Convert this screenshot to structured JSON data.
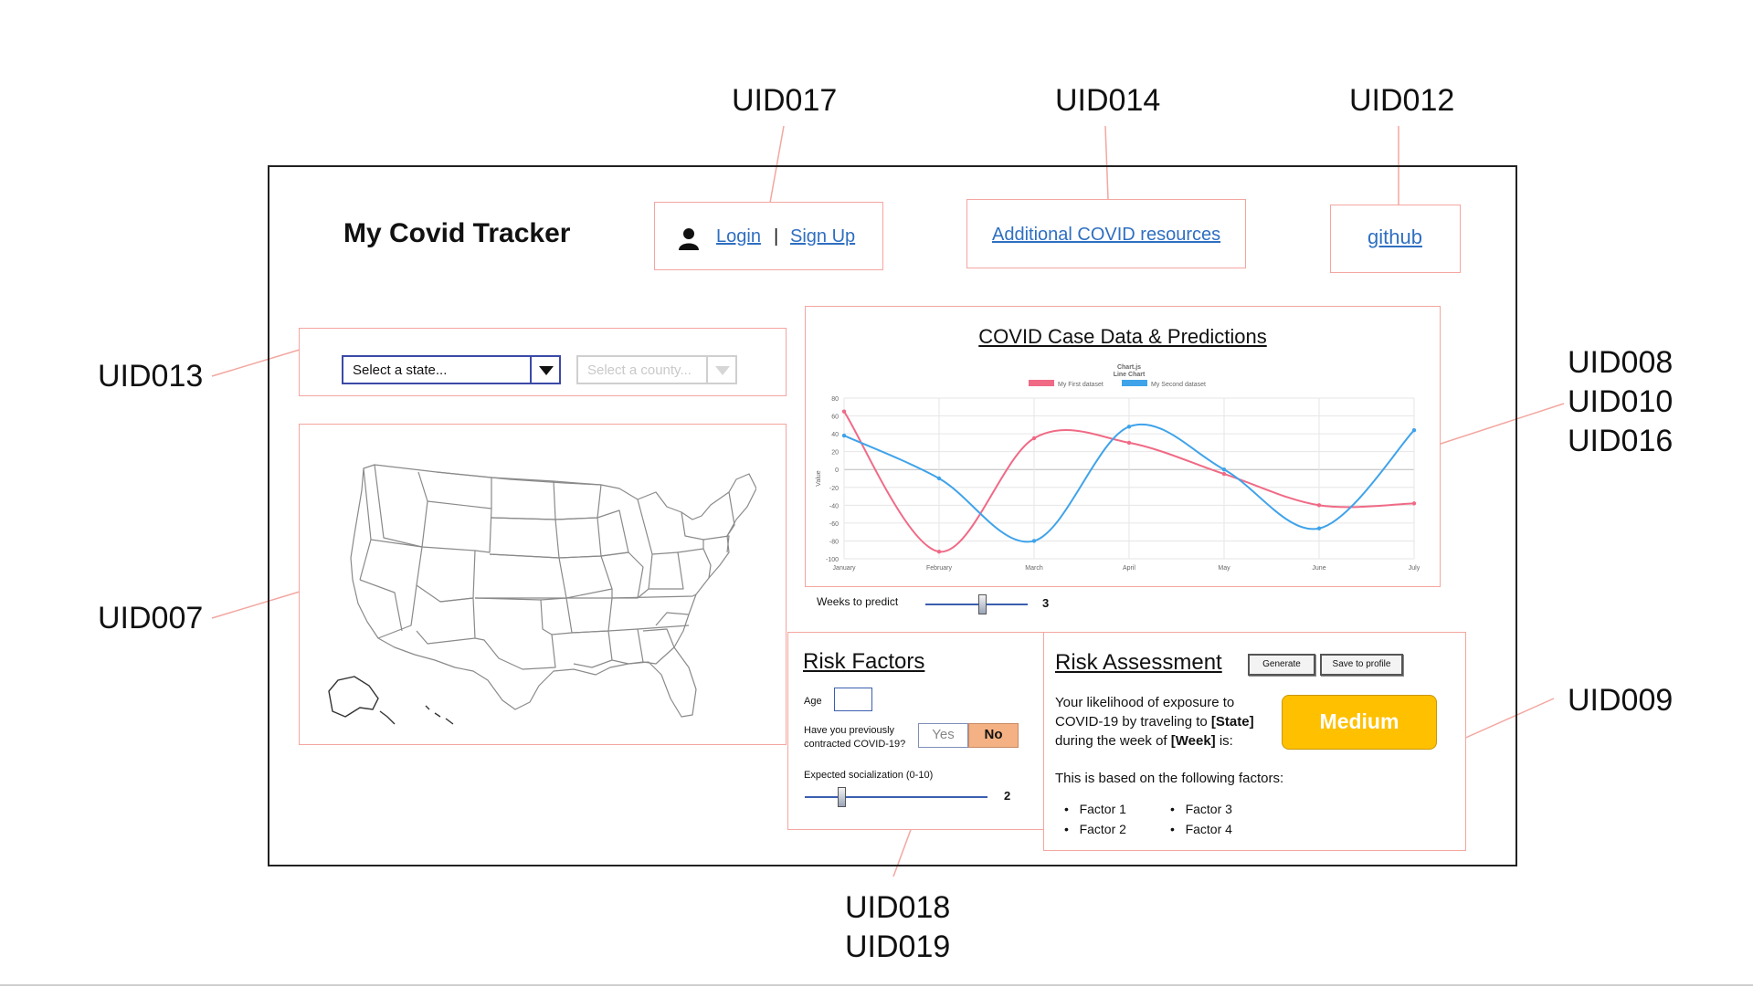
{
  "annotations": {
    "uid017": "UID017",
    "uid014": "UID014",
    "uid012": "UID012",
    "uid013": "UID013",
    "uid007": "UID007",
    "uid008": "UID008",
    "uid010": "UID010",
    "uid016": "UID016",
    "uid009": "UID009",
    "uid018": "UID018",
    "uid019": "UID019"
  },
  "header": {
    "app_title": "My Covid Tracker",
    "login": "Login",
    "separator": "|",
    "signup": "Sign Up",
    "resources": "Additional COVID resources",
    "github": "github"
  },
  "selectors": {
    "state_value": "Select a state...",
    "county_value": "Select a county..."
  },
  "chart": {
    "title": "COVID Case Data & Predictions",
    "weeks_label": "Weeks to predict",
    "weeks_value": "3",
    "weeks_fraction": 0.55
  },
  "chart_data": {
    "type": "line",
    "title": "Chart.js Line Chart",
    "ylabel": "Value",
    "xlabel": "",
    "categories": [
      "January",
      "February",
      "March",
      "April",
      "May",
      "June",
      "July"
    ],
    "ylim": [
      -100,
      80
    ],
    "yticks": [
      80,
      60,
      40,
      20,
      0,
      -20,
      -40,
      -60,
      -80,
      -100
    ],
    "grid": true,
    "legend": "top",
    "series": [
      {
        "name": "My First dataset",
        "color": "#f06a86",
        "values": [
          65,
          -92,
          35,
          30,
          -5,
          -40,
          -38
        ]
      },
      {
        "name": "My Second dataset",
        "color": "#3fa3ea",
        "values": [
          38,
          -10,
          -80,
          48,
          0,
          -66,
          44
        ]
      }
    ]
  },
  "risk_factors": {
    "title": "Risk Factors",
    "age_label": "Age",
    "age_value": "",
    "contracted_label_1": "Have you previously",
    "contracted_label_2": "contracted COVID-19?",
    "yes": "Yes",
    "no": "No",
    "socialization_label": "Expected socialization (0-10)",
    "socialization_value": "2",
    "socialization_fraction": 0.2
  },
  "risk_assessment": {
    "title": "Risk Assessment",
    "generate": "Generate",
    "save": "Save to profile",
    "line1": "Your likelihood of exposure to",
    "line2_pre": "COVID-19 by traveling to ",
    "line2_bold": "[State]",
    "line3_pre": "during the week of ",
    "line3_bold": "[Week]",
    "line3_post": " is:",
    "level": "Medium",
    "level_color": "#ffc000",
    "based_on": "This is based on the following factors:",
    "factors": [
      "Factor 1",
      "Factor 2",
      "Factor 3",
      "Factor 4"
    ]
  },
  "colors": {
    "accent_pink": "#f4a6a0",
    "link_blue": "#2f6fc1",
    "no_orange": "#f4b183"
  }
}
